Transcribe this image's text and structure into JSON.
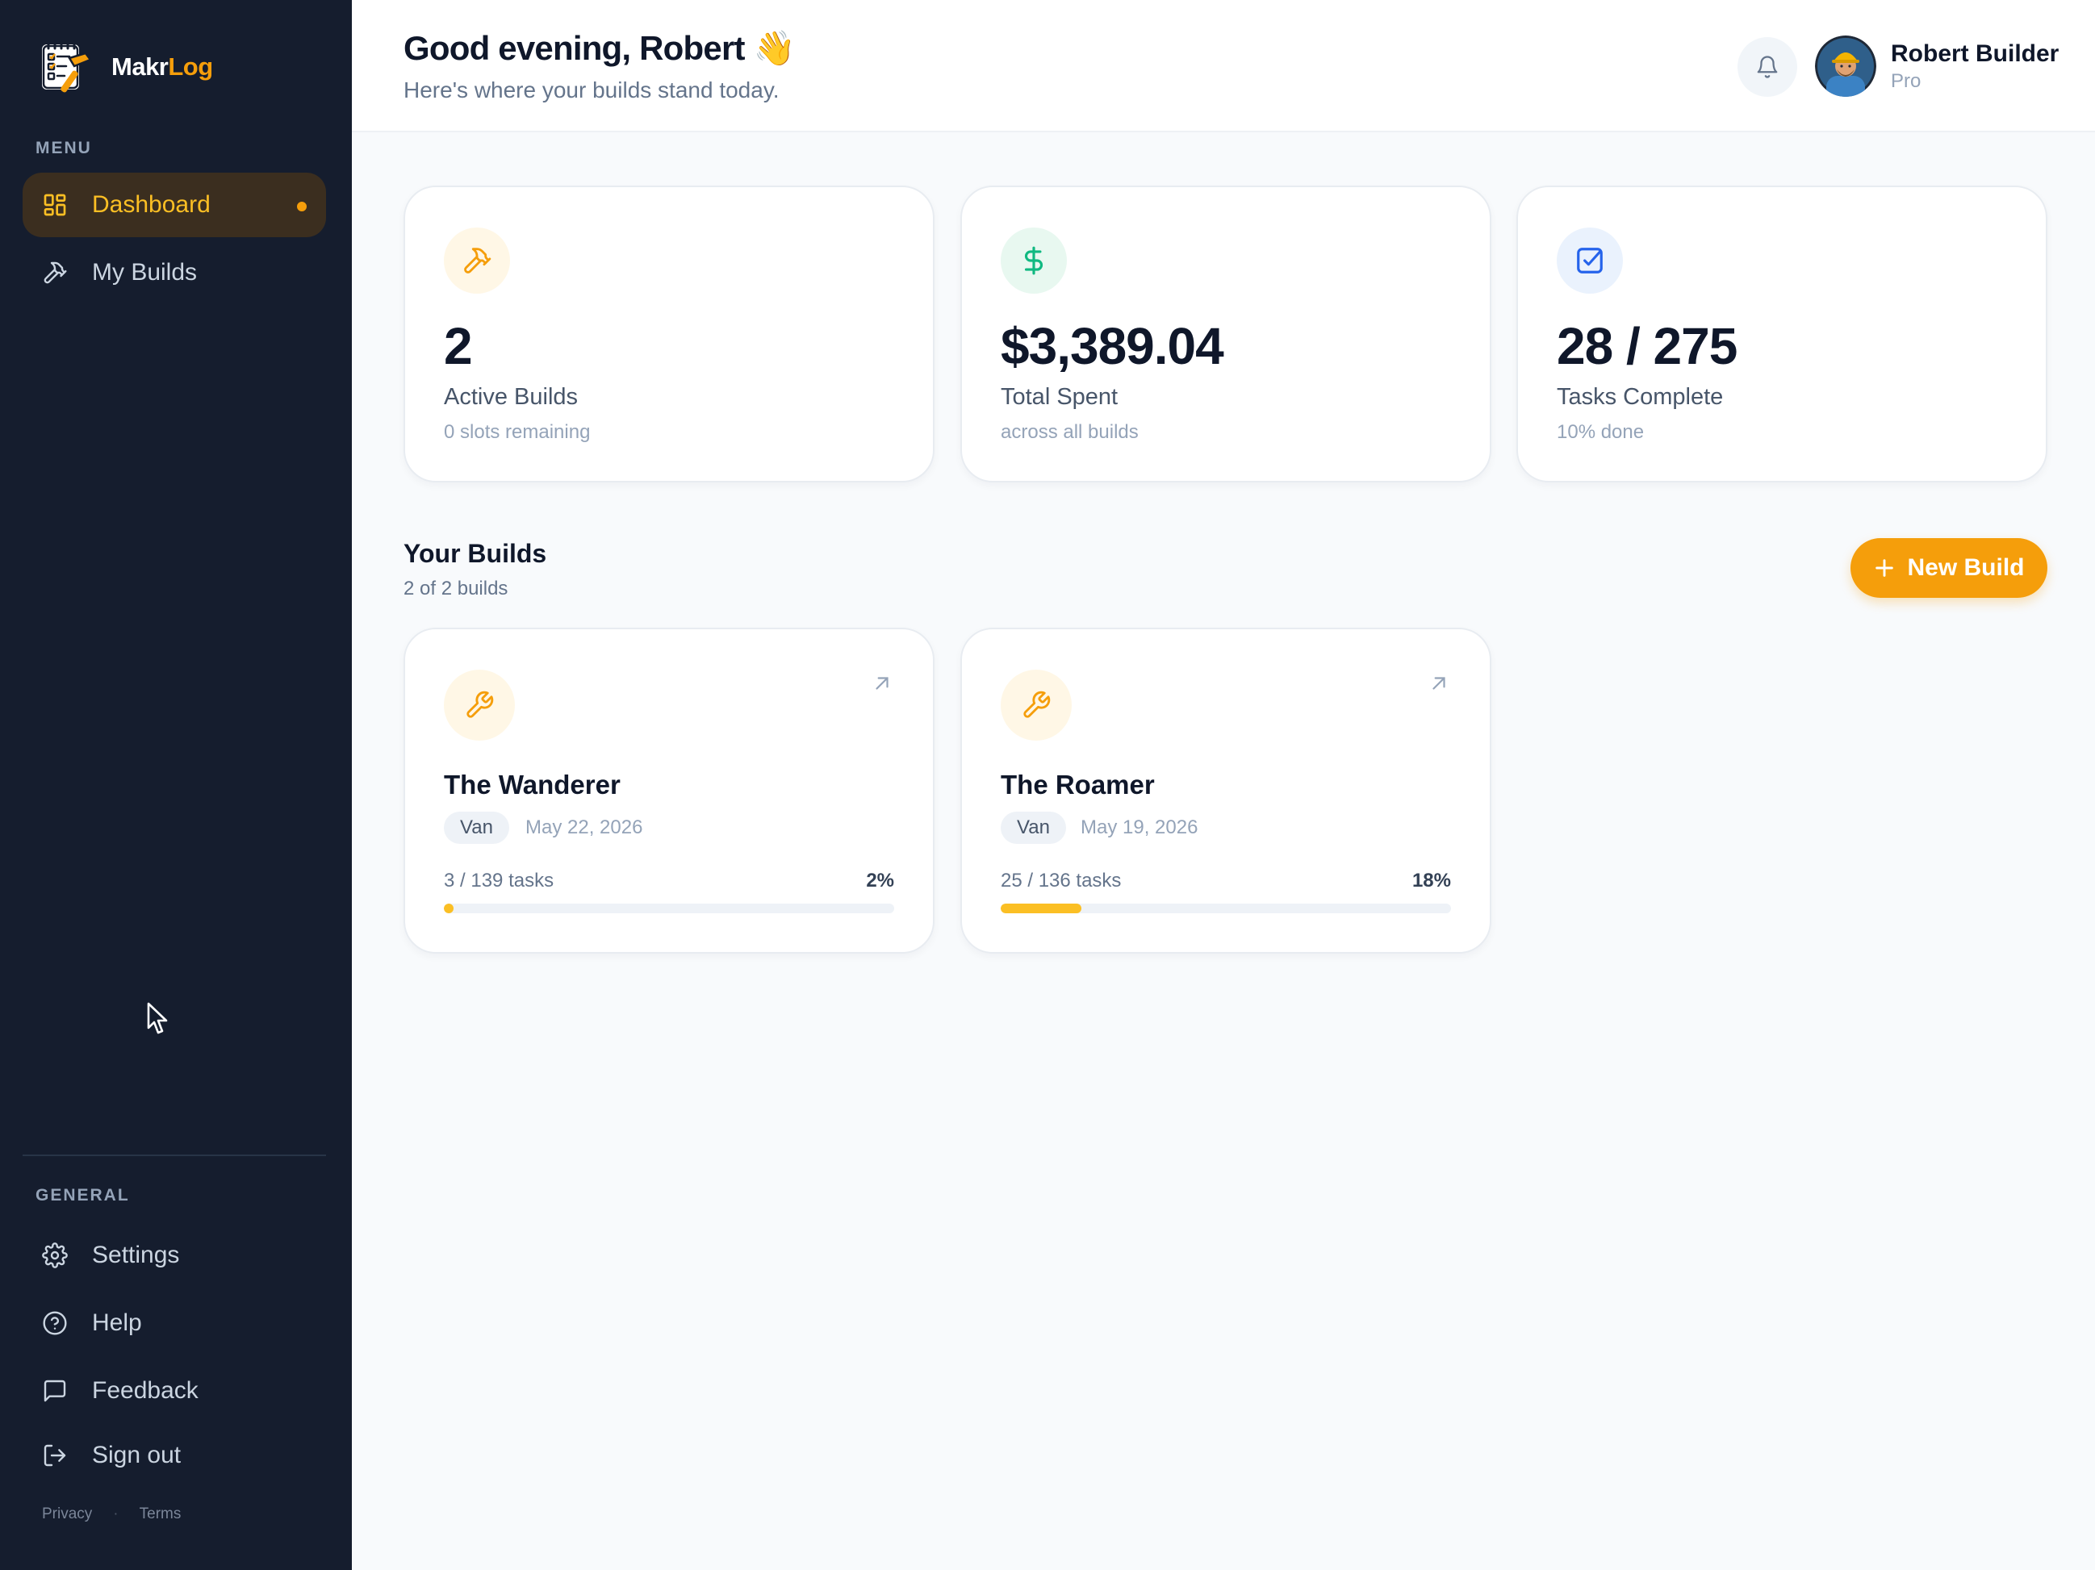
{
  "brand": {
    "name_part1": "Makr",
    "name_part2": "Log",
    "accent_color": "#f59e0b"
  },
  "sidebar": {
    "menu_label": "MENU",
    "menu_items": [
      {
        "label": "Dashboard",
        "icon": "dashboard-grid-icon",
        "active": true
      },
      {
        "label": "My Builds",
        "icon": "hammer-icon",
        "active": false
      }
    ],
    "general_label": "GENERAL",
    "general_items": [
      {
        "label": "Settings",
        "icon": "gear-icon"
      },
      {
        "label": "Help",
        "icon": "help-circle-icon"
      },
      {
        "label": "Feedback",
        "icon": "message-square-icon"
      },
      {
        "label": "Sign out",
        "icon": "sign-out-icon"
      }
    ],
    "footer": {
      "privacy": "Privacy",
      "separator": "·",
      "terms": "Terms"
    }
  },
  "header": {
    "greeting": "Good evening, Robert 👋",
    "subtitle": "Here's where your builds stand today.",
    "user": {
      "name": "Robert Builder",
      "plan": "Pro"
    }
  },
  "stats": [
    {
      "value": "2",
      "label": "Active Builds",
      "sub": "0 slots remaining",
      "icon": "hammer-icon",
      "color": "#f59e0b"
    },
    {
      "value": "$3,389.04",
      "label": "Total Spent",
      "sub": "across all builds",
      "icon": "dollar-icon",
      "color": "#10b981"
    },
    {
      "value": "28 / 275",
      "label": "Tasks Complete",
      "sub": "10% done",
      "icon": "check-square-icon",
      "color": "#2563eb"
    }
  ],
  "builds_section": {
    "title": "Your Builds",
    "count_text": "2 of 2 builds",
    "new_button_label": "New Build"
  },
  "builds": [
    {
      "name": "The Wanderer",
      "type": "Van",
      "date": "May 22, 2026",
      "tasks_text": "3 / 139 tasks",
      "percent_text": "2%",
      "progress": 0.02
    },
    {
      "name": "The Roamer",
      "type": "Van",
      "date": "May 19, 2026",
      "tasks_text": "25 / 136 tasks",
      "percent_text": "18%",
      "progress": 0.18
    }
  ]
}
